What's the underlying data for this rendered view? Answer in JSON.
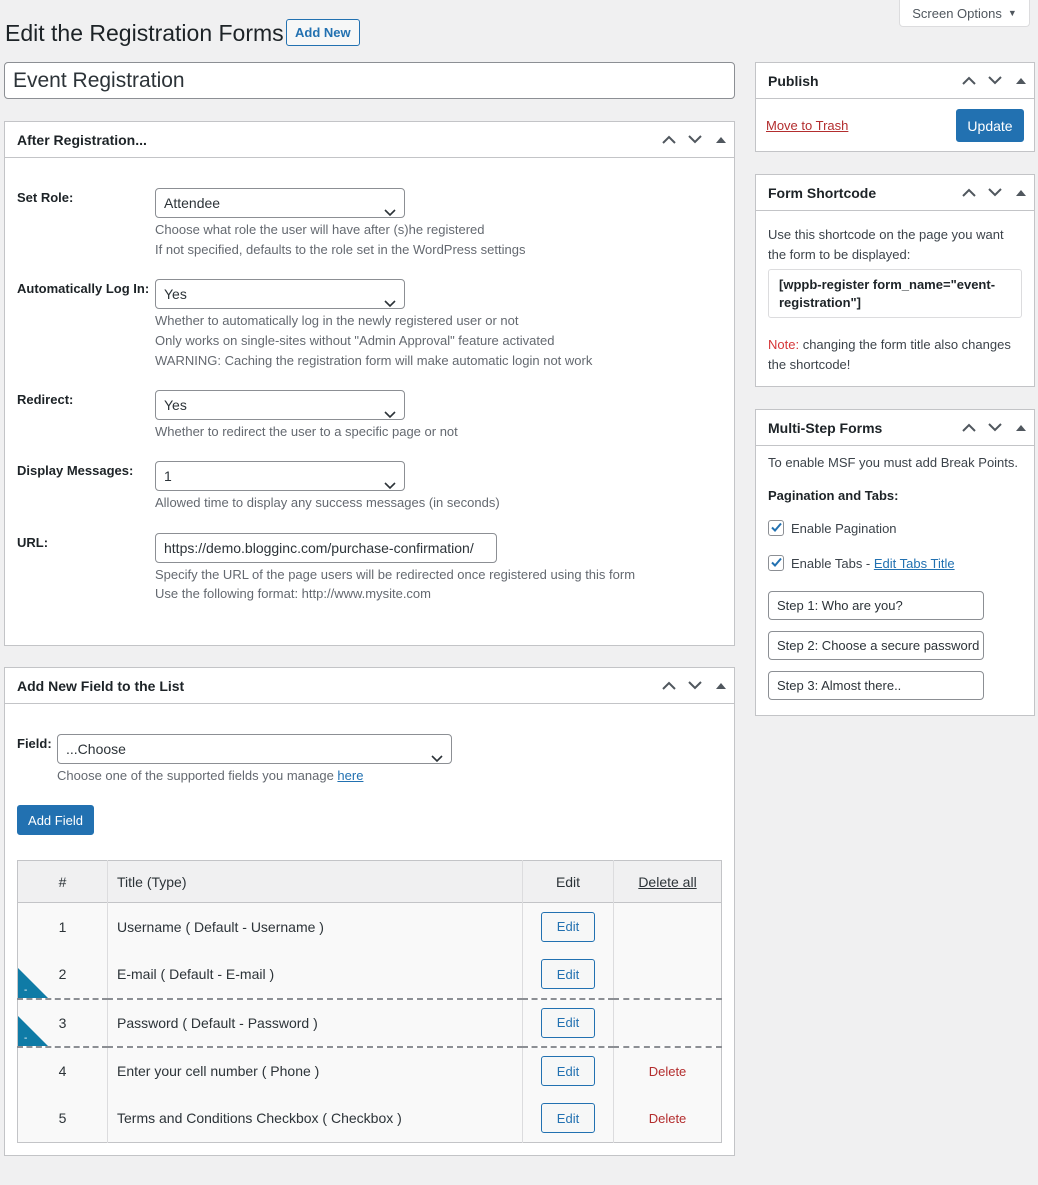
{
  "screen_options": {
    "label": "Screen Options"
  },
  "page": {
    "title": "Edit the Registration Forms",
    "add_new": "Add New",
    "form_title_value": "Event Registration"
  },
  "after_registration": {
    "heading": "After Registration...",
    "set_role": {
      "label": "Set Role:",
      "value": "Attendee",
      "desc1": "Choose what role the user will have after (s)he registered",
      "desc2": "If not specified, defaults to the role set in the WordPress settings"
    },
    "auto_login": {
      "label": "Automatically Log In:",
      "value": "Yes",
      "desc1": "Whether to automatically log in the newly registered user or not",
      "desc2": "Only works on single-sites without \"Admin Approval\" feature activated",
      "desc3": "WARNING: Caching the registration form will make automatic login not work"
    },
    "redirect": {
      "label": "Redirect:",
      "value": "Yes",
      "desc1": "Whether to redirect the user to a specific page or not"
    },
    "display_messages": {
      "label": "Display Messages:",
      "value": "1",
      "desc1": "Allowed time to display any success messages (in seconds)"
    },
    "url": {
      "label": "URL:",
      "value": "https://demo.blogginc.com/purchase-confirmation/",
      "desc1": "Specify the URL of the page users will be redirected once registered using this form",
      "desc2": "Use the following format: http://www.mysite.com"
    }
  },
  "add_field": {
    "heading": "Add New Field to the List",
    "field_label": "Field:",
    "field_value": "...Choose",
    "desc_prefix": "Choose one of the supported fields you manage ",
    "desc_link": "here",
    "button": "Add Field",
    "table": {
      "headers": {
        "num": "#",
        "title": "Title (Type)",
        "edit": "Edit",
        "delete_all": "Delete all"
      },
      "rows": [
        {
          "num": "1",
          "title": "Username ( Default - Username )",
          "edit": "Edit",
          "delete": ""
        },
        {
          "num": "2",
          "title": "E-mail ( Default - E-mail )",
          "edit": "Edit",
          "delete": ""
        },
        {
          "num": "3",
          "title": "Password ( Default - Password )",
          "edit": "Edit",
          "delete": ""
        },
        {
          "num": "4",
          "title": "Enter your cell number ( Phone )",
          "edit": "Edit",
          "delete": "Delete"
        },
        {
          "num": "5",
          "title": "Terms and Conditions Checkbox ( Checkbox )",
          "edit": "Edit",
          "delete": "Delete"
        }
      ],
      "corner_mark": "-"
    }
  },
  "publish": {
    "heading": "Publish",
    "trash": "Move to Trash",
    "update": "Update"
  },
  "shortcode": {
    "heading": "Form Shortcode",
    "desc": "Use this shortcode on the page you want the form to be displayed:",
    "code": "[wppb-register form_name=\"event-registration\"]",
    "note_label": "Note:",
    "note_text": " changing the form title also changes the shortcode!"
  },
  "msf": {
    "heading": "Multi-Step Forms",
    "desc": "To enable MSF you must add Break Points.",
    "pagination_title": "Pagination and Tabs:",
    "enable_pagination": "Enable Pagination",
    "enable_pagination_checked": true,
    "enable_tabs": "Enable Tabs - ",
    "enable_tabs_checked": true,
    "edit_tabs_link": "Edit Tabs Title",
    "steps": [
      "Step 1: Who are you?",
      "Step 2: Choose a secure password",
      "Step 3: Almost there.."
    ]
  },
  "colors": {
    "primary": "#2271b1",
    "danger": "#b32d2e",
    "corner": "#0f7ba6"
  }
}
